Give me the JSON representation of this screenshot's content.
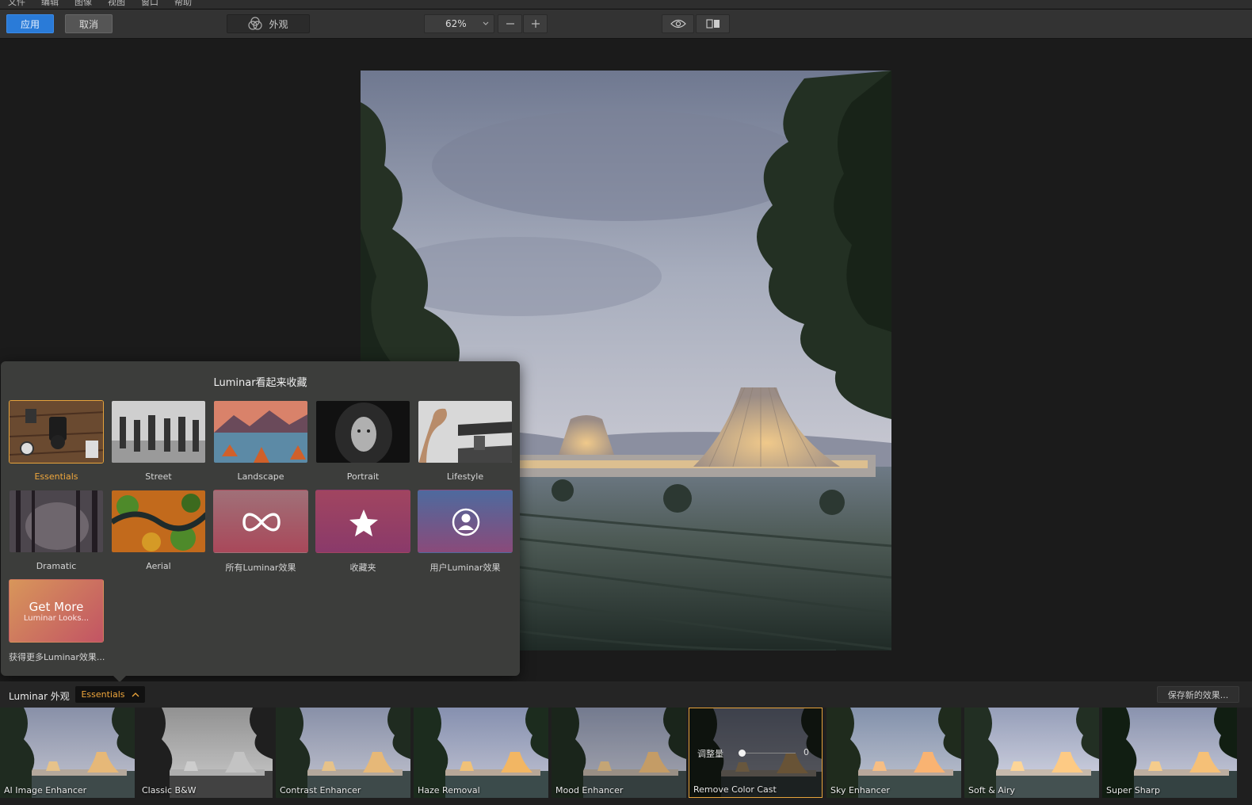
{
  "menubar": {
    "items": [
      "文件",
      "编辑",
      "图像",
      "视图",
      "窗口",
      "帮助"
    ]
  },
  "toolbar": {
    "apply_label": "应用",
    "cancel_label": "取消",
    "looks_label": "外观",
    "zoom_value": "62%"
  },
  "popup": {
    "title": "Luminar看起来收藏",
    "categories": [
      {
        "label": "Essentials",
        "selected": true
      },
      {
        "label": "Street"
      },
      {
        "label": "Landscape"
      },
      {
        "label": "Portrait"
      },
      {
        "label": "Lifestyle"
      },
      {
        "label": "Dramatic"
      },
      {
        "label": "Aerial"
      },
      {
        "label": "所有Luminar效果"
      },
      {
        "label": "收藏夹"
      },
      {
        "label": "用户Luminar效果"
      },
      {
        "label": "获得更多Luminar效果...",
        "tile_title": "Get More",
        "tile_subtitle": "Luminar Looks..."
      }
    ]
  },
  "looksbar": {
    "label": "Luminar 外观",
    "collection": "Essentials",
    "save_label": "保存新的效果..."
  },
  "looks": [
    {
      "label": "AI Image Enhancer"
    },
    {
      "label": "Classic B&W"
    },
    {
      "label": "Contrast Enhancer"
    },
    {
      "label": "Haze Removal"
    },
    {
      "label": "Mood Enhancer"
    },
    {
      "label": "Remove Color Cast",
      "active": true,
      "amount_label": "调整量",
      "amount_value": "0"
    },
    {
      "label": "Sky Enhancer"
    },
    {
      "label": "Soft & Airy"
    },
    {
      "label": "Super Sharp"
    }
  ],
  "colors": {
    "accent": "#2a7bd8",
    "highlight": "#e6a33b",
    "panel": "#3c3d3b"
  }
}
